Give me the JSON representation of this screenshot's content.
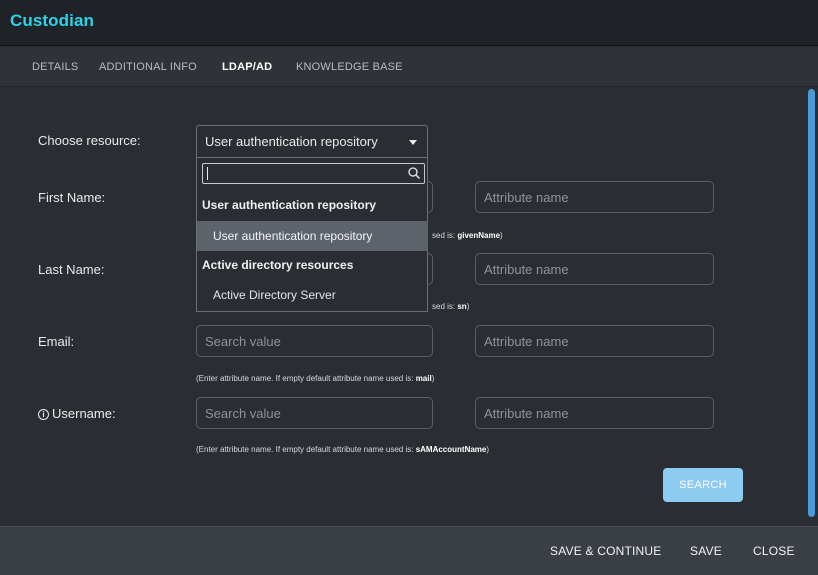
{
  "app": {
    "title": "Custodian"
  },
  "tabs": [
    {
      "label": "DETAILS",
      "active": false
    },
    {
      "label": "ADDITIONAL INFO",
      "active": false
    },
    {
      "label": "LDAP/AD",
      "active": true
    },
    {
      "label": "KNOWLEDGE BASE",
      "active": false
    }
  ],
  "resource": {
    "label": "Choose resource:",
    "selected": "User authentication repository",
    "search_value": ""
  },
  "dropdown": {
    "groups": [
      {
        "label": "User authentication repository",
        "options": [
          {
            "label": "User authentication repository",
            "selected": true
          }
        ]
      },
      {
        "label": "Active directory resources",
        "options": [
          {
            "label": "Active Directory Server",
            "selected": false
          }
        ]
      }
    ]
  },
  "fields": {
    "first_name": {
      "label": "First Name:",
      "search_placeholder": "Search value",
      "attribute_placeholder": "Attribute name",
      "hint_tail": "sed is:",
      "hint_value": "givenName"
    },
    "last_name": {
      "label": "Last Name:",
      "search_placeholder": "Search value",
      "attribute_placeholder": "Attribute name",
      "hint_tail": "sed is:",
      "hint_value": "sn"
    },
    "email": {
      "label": "Email:",
      "search_placeholder": "Search value",
      "attribute_placeholder": "Attribute name",
      "hint": "(Enter attribute name. If empty default attribute name used is:",
      "hint_value": "mail"
    },
    "username": {
      "label": "Username:",
      "search_placeholder": "Search value",
      "attribute_placeholder": "Attribute name",
      "hint": "(Enter attribute name. If empty default attribute name used is:",
      "hint_value": "sAMAccountName"
    }
  },
  "buttons": {
    "search": "SEARCH",
    "save_continue": "SAVE & CONTINUE",
    "save": "SAVE",
    "close": "CLOSE"
  },
  "colors": {
    "title_accent": "#2bd4e8",
    "search_button": "#8ecbf0",
    "scrollbar": "#4a99d8",
    "selected_option": "#5d636b"
  }
}
